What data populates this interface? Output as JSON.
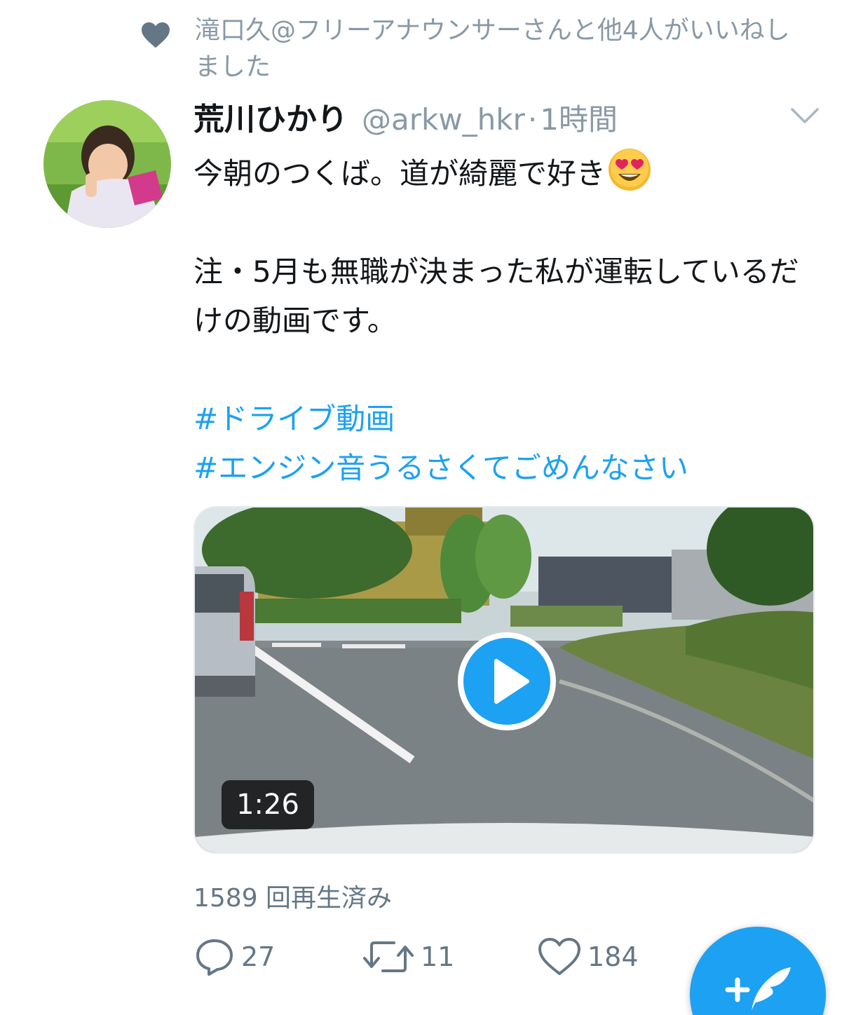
{
  "social_context": {
    "icon": "heart-icon",
    "text": "滝口久@フリーアナウンサーさんと他4人がいいねしました"
  },
  "tweet": {
    "display_name": "荒川ひかり",
    "handle": "@arkw_hkr",
    "separator": "·",
    "time": "1時間",
    "menu_icon": "chevron-down-icon",
    "line1": "今朝のつくば。道が綺麗で好き",
    "line1_emoji": "heart-eyes-emoji",
    "line2": "注・5月も無職が決まった私が運転しているだけの動画です。",
    "hashtags": [
      "#ドライブ動画",
      "#エンジン音うるさくてごめんなさい"
    ]
  },
  "video": {
    "duration": "1:26",
    "play_icon": "play-icon",
    "views": "1589 回再生済み"
  },
  "actions": {
    "reply_count": "27",
    "retweet_count": "11",
    "like_count": "184"
  },
  "fab": {
    "icon": "compose-tweet-icon",
    "color": "#1da1f2"
  },
  "colors": {
    "accent": "#1da1f2",
    "muted": "#8899a6",
    "text": "#14171a"
  }
}
